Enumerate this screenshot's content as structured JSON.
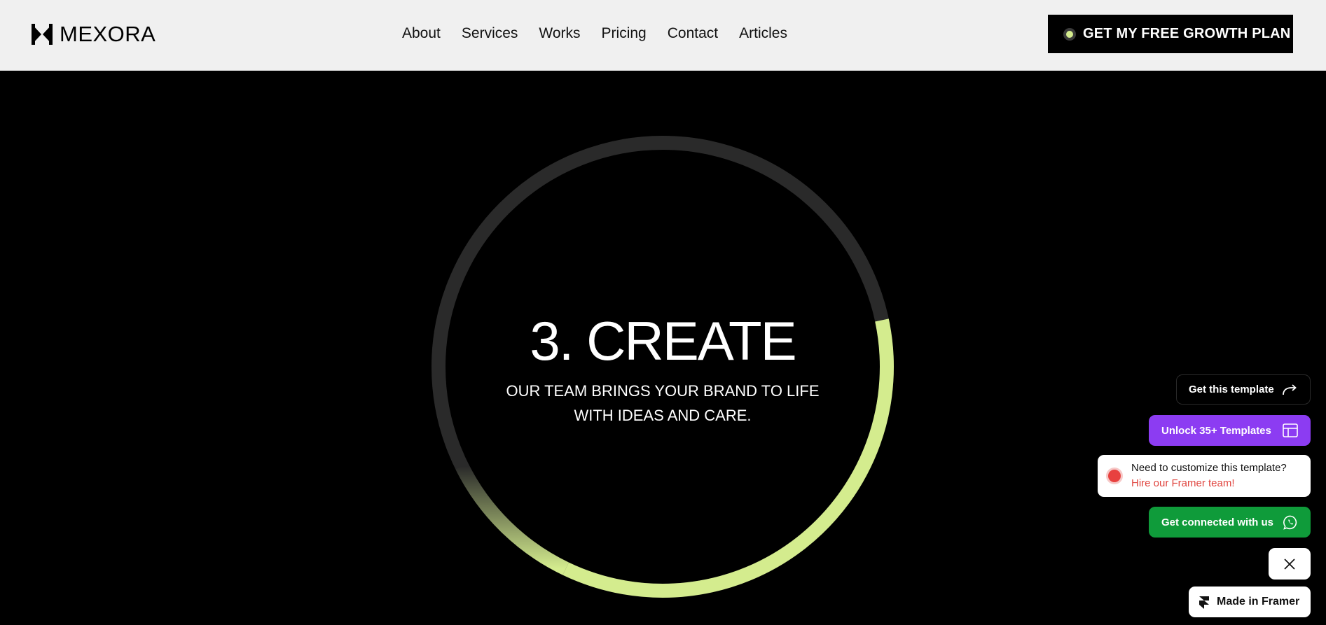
{
  "brand": {
    "name": "MEXORA",
    "logo_icon": "mexora-logo-icon"
  },
  "nav": {
    "items": [
      "About",
      "Services",
      "Works",
      "Pricing",
      "Contact",
      "Articles"
    ]
  },
  "cta": {
    "label": "GET MY FREE GROWTH PLAN",
    "dot_color": "#d4ec8e"
  },
  "step": {
    "title": "3. CREATE",
    "description_line1": "OUR TEAM BRINGS YOUR BRAND TO LIFE",
    "description_line2": "WITH IDEAS AND CARE.",
    "progress": 0.46,
    "accent_color": "#d4ec8e",
    "track_color": "#2a2a2a"
  },
  "floating": {
    "get_template": "Get this template",
    "unlock": "Unlock 35+ Templates",
    "hire_line1": "Need to customize this template?",
    "hire_line2": "Hire our Framer team!",
    "whatsapp": "Get connected with us",
    "made_in_framer": "Made in Framer"
  },
  "colors": {
    "header_bg": "#f0f0f0",
    "unlock_bg": "#8c3cf2",
    "whatsapp_bg": "#0f9b3a",
    "hire_accent": "#e0453f"
  }
}
